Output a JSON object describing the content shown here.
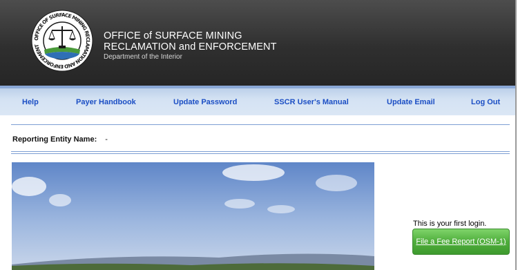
{
  "header": {
    "seal_text": "OFFICE OF SURFACE MINING RECLAMATION AND ENFORCEMENT",
    "agency_line1": "OFFICE of SURFACE MINING",
    "agency_line2": "RECLAMATION and ENFORCEMENT",
    "agency_line3": "Department of the Interior"
  },
  "nav": {
    "items": [
      {
        "label": "Help"
      },
      {
        "label": "Payer Handbook"
      },
      {
        "label": "Update Password"
      },
      {
        "label": "SSCR User's Manual"
      },
      {
        "label": "Update Email"
      },
      {
        "label": "Log Out"
      }
    ]
  },
  "main": {
    "entity_label": "Reporting Entity Name:",
    "entity_value": "-",
    "first_login_text": "This is your first login.",
    "file_button_label": "File a Fee Report (OSM-1)"
  },
  "colors": {
    "header_bg": "#2f2f2f",
    "nav_bg": "#d4e2f3",
    "nav_link": "#1b4ec4",
    "button_green": "#4fae3c"
  }
}
